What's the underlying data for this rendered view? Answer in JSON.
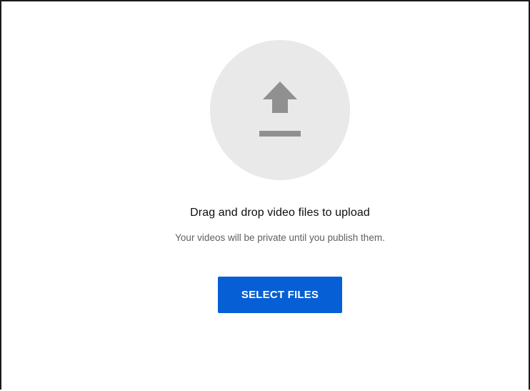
{
  "upload": {
    "icon": "upload-arrow-icon",
    "title": "Drag and drop video files to upload",
    "subtitle": "Your videos will be private until you publish them.",
    "button_label": "SELECT FILES"
  },
  "colors": {
    "accent": "#065fd4",
    "circle_bg": "#e9e9e9",
    "icon": "#909090",
    "title_text": "#0d0d0d",
    "subtitle_text": "#606060"
  }
}
